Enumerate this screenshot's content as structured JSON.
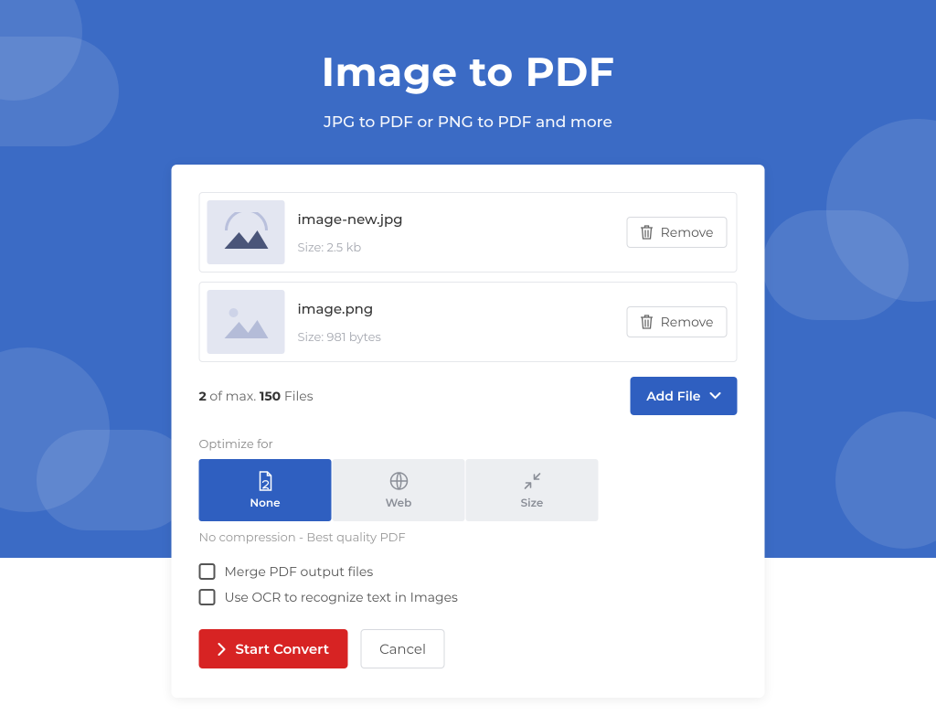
{
  "header": {
    "title": "Image to PDF",
    "subtitle": "JPG to PDF or PNG to PDF and more"
  },
  "files": [
    {
      "name": "image-new.jpg",
      "size_label": "Size: 2.5 kb",
      "remove_label": "Remove"
    },
    {
      "name": "image.png",
      "size_label": "Size: 981 bytes",
      "remove_label": "Remove"
    }
  ],
  "counter": {
    "current": "2",
    "mid": " of max. ",
    "max": "150",
    "suffix": " Files"
  },
  "add_file_label": "Add File",
  "optimize": {
    "section_label": "Optimize for",
    "tabs": [
      {
        "id": "none",
        "label": "None",
        "active": true
      },
      {
        "id": "web",
        "label": "Web",
        "active": false
      },
      {
        "id": "size",
        "label": "Size",
        "active": false
      }
    ],
    "description": "No compression - Best quality PDF"
  },
  "options": {
    "merge_label": "Merge PDF output files",
    "ocr_label": "Use OCR to recognize text in Images"
  },
  "actions": {
    "convert_label": "Start Convert",
    "cancel_label": "Cancel"
  }
}
